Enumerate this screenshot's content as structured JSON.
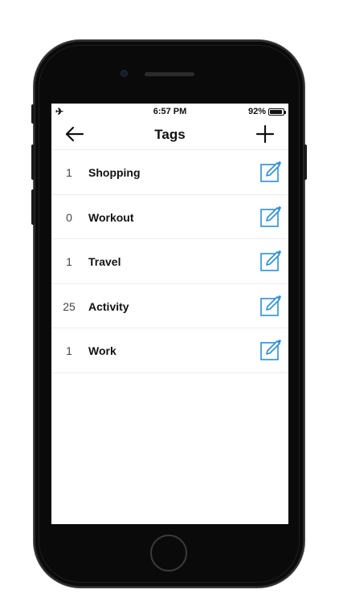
{
  "status_bar": {
    "left_icon": "airplane-icon",
    "time": "6:57 PM",
    "battery_percent": "92%",
    "battery_level": 0.92
  },
  "nav": {
    "title": "Tags",
    "back_icon": "arrow-left-icon",
    "add_icon": "plus-icon"
  },
  "tags": [
    {
      "count": "1",
      "name": "Shopping"
    },
    {
      "count": "0",
      "name": "Workout"
    },
    {
      "count": "1",
      "name": "Travel"
    },
    {
      "count": "25",
      "name": "Activity"
    },
    {
      "count": "1",
      "name": "Work"
    }
  ],
  "colors": {
    "accent": "#2b8fd6",
    "text": "#111111",
    "count_text": "#444444",
    "divider": "#ececec"
  },
  "edit_icon": "edit-icon"
}
